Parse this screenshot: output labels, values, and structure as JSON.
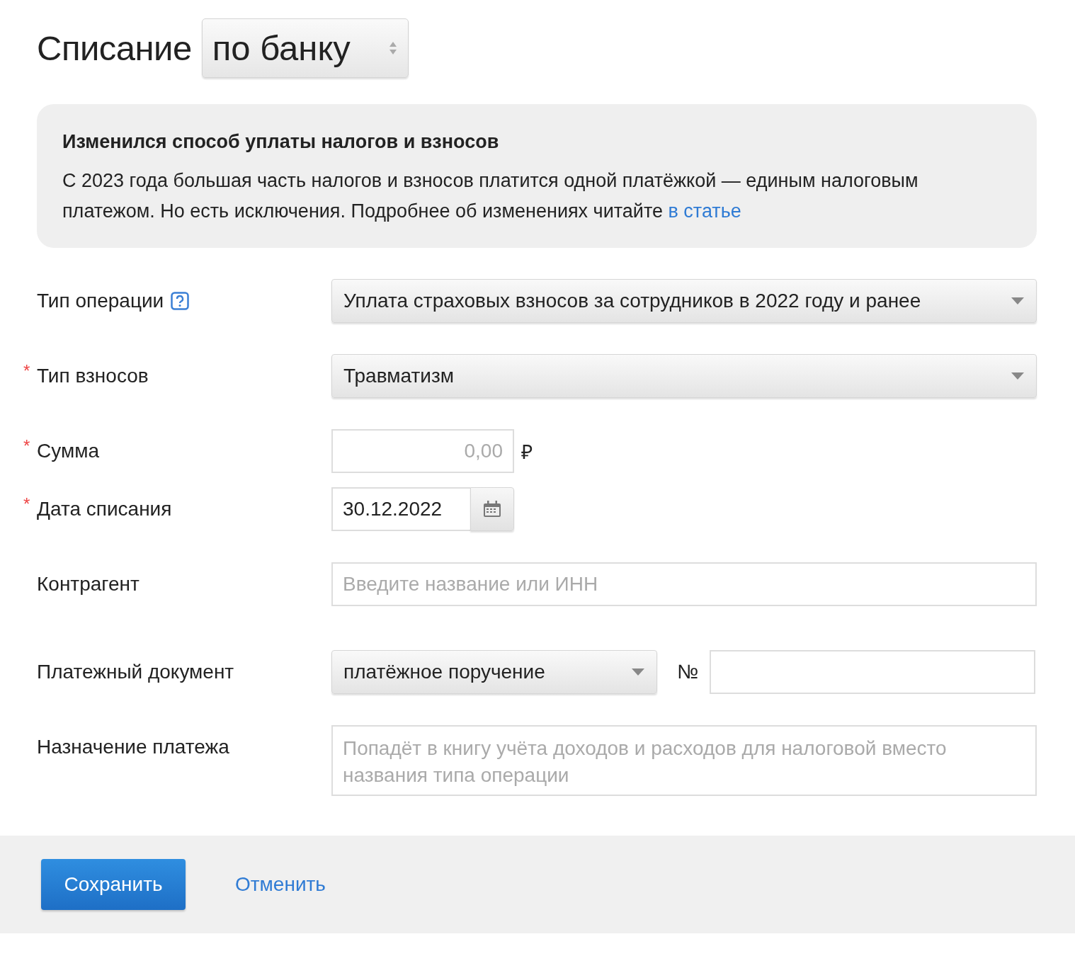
{
  "header": {
    "title": "Списание",
    "mode_select": {
      "value": "по банку"
    }
  },
  "notice": {
    "title": "Изменился способ уплаты налогов и взносов",
    "text": "С 2023 года большая часть налогов и взносов платится одной платёжкой — единым налоговым платежом. Но есть исключения. Подробнее об изменениях читайте",
    "link": "в статье"
  },
  "fields": [
    {
      "kind": "select",
      "label": "Тип операции",
      "help": true,
      "value": "Уплата страховых взносов за сотрудников в 2022 году и ранее"
    },
    {
      "kind": "select",
      "label": "Тип взносов",
      "required_mark": "*",
      "value": "Травматизм"
    },
    {
      "kind": "amount",
      "label": "Сумма",
      "required_mark": "*",
      "placeholder": "0,00",
      "currency": "₽"
    },
    {
      "kind": "date",
      "label": "Дата списания",
      "required_mark": "*",
      "value": "30.12.2022"
    },
    {
      "kind": "text",
      "label": "Контрагент",
      "placeholder": "Введите название или ИНН"
    },
    {
      "kind": "document",
      "label": "Платежный документ",
      "value": "платёжное поручение",
      "number_label": "№"
    },
    {
      "kind": "textarea",
      "label": "Назначение платежа",
      "placeholder": "Попадёт в книгу учёта доходов и расходов для налоговой вместо названия типа операции"
    }
  ],
  "footer": {
    "save": "Сохранить",
    "cancel": "Отменить"
  }
}
